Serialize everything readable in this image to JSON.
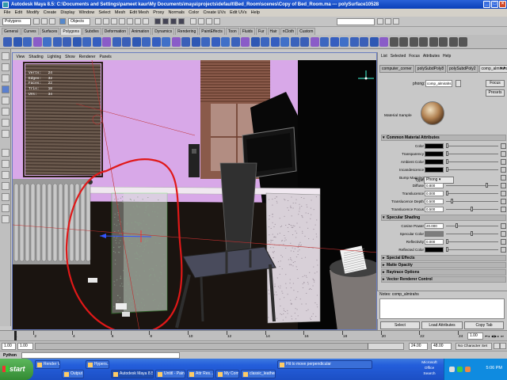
{
  "window": {
    "title": "Autodesk Maya 8.5: C:\\Documents and Settings\\pameet kaur\\My Documents\\maya\\projects\\default\\Bed_Room\\scenes\\Copy of Bed_Room.ma  ---  polySurface10528",
    "min": "_",
    "max": "□",
    "close": "×"
  },
  "menubar": [
    "File",
    "Edit",
    "Modify",
    "Create",
    "Display",
    "Window",
    "Select",
    "Mesh",
    "Edit Mesh",
    "Proxy",
    "Normals",
    "Color",
    "Create UVs",
    "Edit UVs",
    "Help"
  ],
  "statusline": {
    "mode": "Polygons",
    "objects_label": "Objects"
  },
  "shelf_tabs": [
    {
      "label": "General"
    },
    {
      "label": "Curves"
    },
    {
      "label": "Surfaces"
    },
    {
      "label": "Polygons",
      "active": true
    },
    {
      "label": "Subdivs"
    },
    {
      "label": "Deformation"
    },
    {
      "label": "Animation"
    },
    {
      "label": "Dynamics"
    },
    {
      "label": "Rendering"
    },
    {
      "label": "PaintEffects"
    },
    {
      "label": "Toon"
    },
    {
      "label": "Fluids"
    },
    {
      "label": "Fur"
    },
    {
      "label": "Hair"
    },
    {
      "label": "nCloth"
    },
    {
      "label": "Custom"
    }
  ],
  "viewport": {
    "menu": [
      "View",
      "Shading",
      "Lighting",
      "Show",
      "Renderer",
      "Panels"
    ],
    "hud": [
      {
        "label": "Verts:",
        "a": "",
        "b": "24"
      },
      {
        "label": "Edges:",
        "a": "",
        "b": "32"
      },
      {
        "label": "Faces:",
        "a": "",
        "b": "22"
      },
      {
        "label": "Tris:",
        "a": "",
        "b": "18"
      },
      {
        "label": "UVs:",
        "a": "",
        "b": "34"
      }
    ]
  },
  "attribute_editor": {
    "menu": [
      "List",
      "Selected",
      "Focus",
      "Attributes",
      "Help"
    ],
    "tabs": [
      {
        "label": "computer_corner"
      },
      {
        "label": "polySubdPoly8"
      },
      {
        "label": "polySubdPoly2"
      },
      {
        "label": "comp_almirahs",
        "active": true
      }
    ],
    "node_type_label": "phong:",
    "node_name": "comp_almirahs",
    "focus_button": "Focus",
    "presets_button": "Presets",
    "material_sample_label": "Material Sample",
    "type_label": "Type",
    "type_value": "Phong",
    "sections": {
      "common": "Common Material Attributes",
      "specular": "Specular Shading",
      "special": "Special Effects",
      "matte": "Matte Opacity",
      "raytrace": "Raytrace Options",
      "vector": "Vector Renderer Control"
    },
    "common_attrs": [
      {
        "label": "Color",
        "kind": "swatch",
        "color": "#000000"
      },
      {
        "label": "Transparency",
        "kind": "swatch",
        "color": "#000000"
      },
      {
        "label": "Ambient Color",
        "kind": "swatch",
        "color": "#000000"
      },
      {
        "label": "Incandescence",
        "kind": "swatch",
        "color": "#000000"
      },
      {
        "label": "Bump Mapping",
        "kind": "none"
      },
      {
        "label": "Diffuse",
        "kind": "num",
        "value": "0.800",
        "level": 0.8
      },
      {
        "label": "Translucence",
        "kind": "num",
        "value": "0.000",
        "level": 0.0
      },
      {
        "label": "Translucence Depth",
        "kind": "num",
        "value": "0.500",
        "level": 0.1
      },
      {
        "label": "Translucence Focus",
        "kind": "num",
        "value": "0.500",
        "level": 0.5
      }
    ],
    "specular_attrs": [
      {
        "label": "Cosine Power",
        "kind": "num",
        "value": "20.000",
        "level": 0.2
      },
      {
        "label": "Specular Color",
        "kind": "swatch",
        "color": "#7d7d7d",
        "level": 0.5
      },
      {
        "label": "Reflectivity",
        "kind": "num",
        "value": "0.000",
        "level": 0.0
      },
      {
        "label": "Reflected Color",
        "kind": "swatch",
        "color": "#000000"
      }
    ],
    "notes_label": "Notes:",
    "notes_name": "comp_almirahs",
    "buttons": {
      "select": "Select",
      "load": "Load Attributes",
      "copy": "Copy Tab"
    }
  },
  "timeline": {
    "ticks": [
      "1",
      "2",
      "4",
      "6",
      "8",
      "10",
      "12",
      "14",
      "16",
      "18",
      "20",
      "22",
      "24"
    ],
    "current_frame": "1.00",
    "range_start": "1.00",
    "range_start_inner": "1.00",
    "range_end": "24.00",
    "range_end_outer": "48.00",
    "character_set": "No Character Set"
  },
  "command_line": {
    "label": "Python"
  },
  "taskbar": {
    "start": "start",
    "tasks": [
      {
        "label": "Render View"
      },
      {
        "label": "Output Window"
      },
      {
        "label": "Hypers..."
      },
      {
        "label": "Autodesk Maya 8.5: C:...",
        "active": true
      },
      {
        "label": "Untitl - Paint"
      },
      {
        "label": "Attr Res..."
      },
      {
        "label": "My Computer"
      },
      {
        "label": "classic_leather_chair..."
      },
      {
        "label": "Hit to move perpendicular"
      }
    ],
    "input_lang": "Microsoft Office Search",
    "clock": "5:06 PM"
  }
}
